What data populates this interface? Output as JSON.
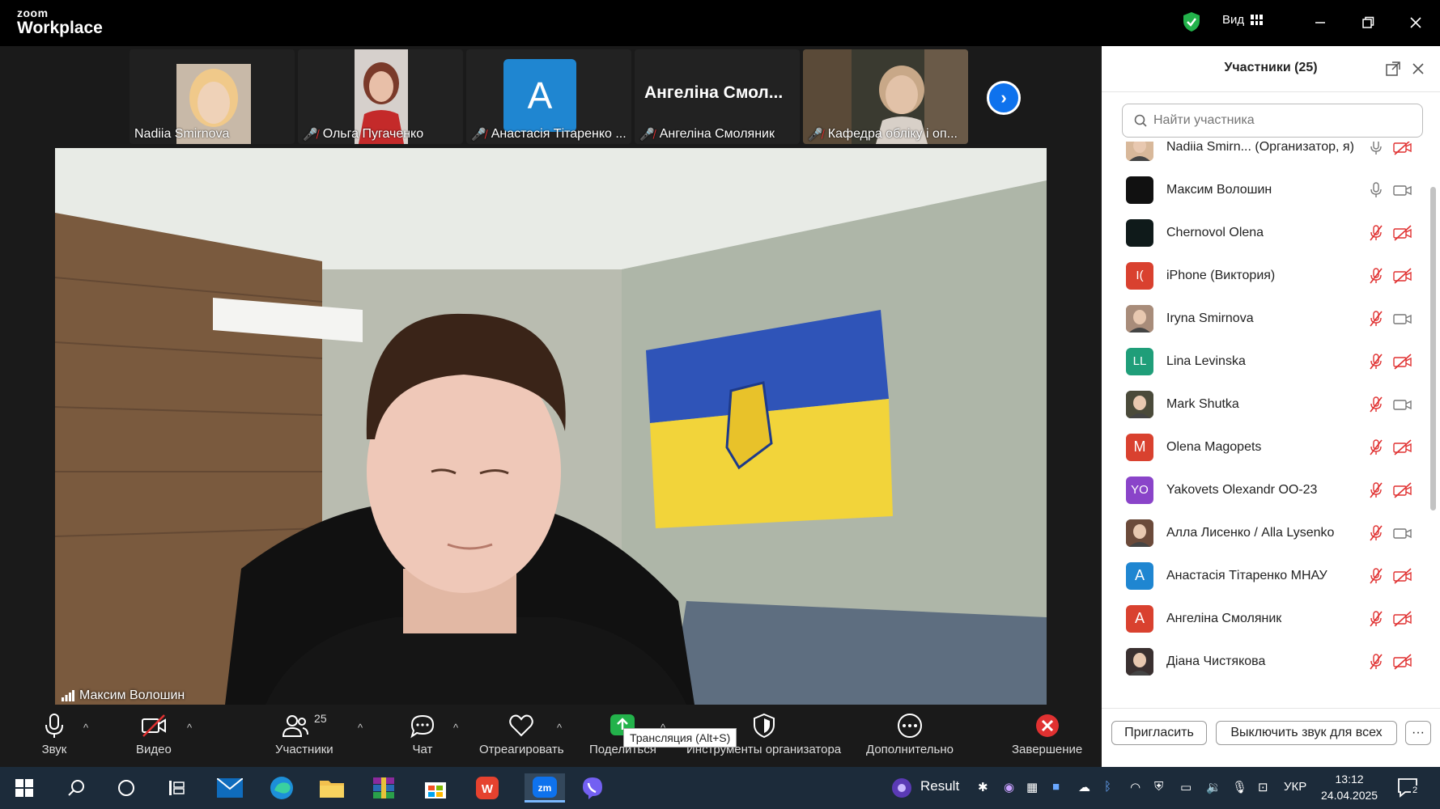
{
  "app": {
    "logo_top": "zoom",
    "logo_bottom": "Workplace",
    "view_label": "Вид"
  },
  "filmstrip": [
    {
      "name": "Nadiia Smirnova",
      "muted": false
    },
    {
      "name": "Ольга Пугаченко",
      "muted": true
    },
    {
      "name": "Анастасія Тітаренко ...",
      "muted": true,
      "initial": "A"
    },
    {
      "name": "Ангеліна Смоляник",
      "muted": true,
      "big_name": "Ангеліна Смол..."
    },
    {
      "name": "Кафедра обліку і оп...",
      "muted": true
    }
  ],
  "main_video": {
    "speaker": "Максим Волошин"
  },
  "toolbar": {
    "audio": "Звук",
    "video": "Видео",
    "participants": "Участники",
    "participants_count": "25",
    "chat": "Чат",
    "react": "Отреагировать",
    "share": "Поделиться",
    "host_tools": "Инструменты организатора",
    "more": "Дополнительно",
    "end": "Завершение",
    "tooltip": "Трансляция (Alt+S)"
  },
  "panel": {
    "title": "Участники (25)",
    "search_placeholder": "Найти участника",
    "participants": [
      {
        "name": "Nadiia Smirn...  (Организатор, я)",
        "avatar": "photo",
        "color": "#d8b89a",
        "mic": "on",
        "cam": "off"
      },
      {
        "name": "Максим Волошин",
        "avatar": "",
        "color": "#111111",
        "mic": "on",
        "cam": "on"
      },
      {
        "name": "Chernovol Olena",
        "avatar": "",
        "color": "#0f1a1a",
        "mic": "off",
        "cam": "off"
      },
      {
        "name": "iPhone (Виктория)",
        "avatar": "I(",
        "color": "#d9412f",
        "mic": "off",
        "cam": "off"
      },
      {
        "name": "Iryna Smirnova",
        "avatar": "photo",
        "color": "#a88c7a",
        "mic": "off",
        "cam": "on"
      },
      {
        "name": "Lina Levinska",
        "avatar": "LL",
        "color": "#1f9e79",
        "mic": "off",
        "cam": "off"
      },
      {
        "name": "Mark Shutka",
        "avatar": "photo",
        "color": "#4a4a3a",
        "mic": "off",
        "cam": "on"
      },
      {
        "name": "Olena Magopets",
        "avatar": "M",
        "color": "#d9412f",
        "mic": "off",
        "cam": "off"
      },
      {
        "name": "Yakovets Olexandr ОО-23",
        "avatar": "YO",
        "color": "#8a44c9",
        "mic": "off",
        "cam": "off"
      },
      {
        "name": "Алла Лисенко / Alla Lysenko",
        "avatar": "photo",
        "color": "#6b4a3a",
        "mic": "off",
        "cam": "on"
      },
      {
        "name": "Анастасія Тітаренко МНАУ",
        "avatar": "A",
        "color": "#1f86d1",
        "mic": "off",
        "cam": "off"
      },
      {
        "name": "Ангеліна Смоляник",
        "avatar": "A",
        "color": "#d9412f",
        "mic": "off",
        "cam": "off"
      },
      {
        "name": "Діана Чистякова",
        "avatar": "photo",
        "color": "#3a3030",
        "mic": "off",
        "cam": "off"
      }
    ],
    "invite": "Пригласить",
    "mute_all": "Выключить звук для всех",
    "more": "···"
  },
  "taskbar": {
    "result": "Result",
    "lang": "УКР",
    "time": "13:12",
    "date": "24.04.2025",
    "notifications": "2"
  },
  "colors": {
    "accent": "#0e72ed",
    "danger": "#e03131",
    "share_green": "#23b24b"
  }
}
